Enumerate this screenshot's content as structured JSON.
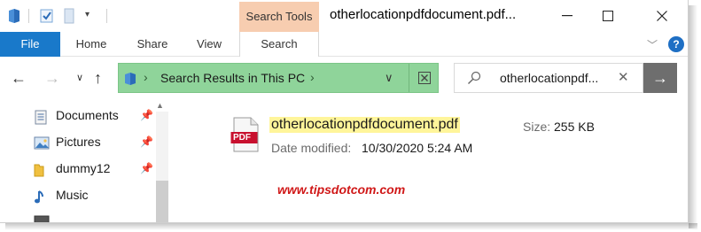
{
  "window": {
    "title": "otherlocationpdfdocument.pdf...",
    "context_tab": "Search Tools",
    "controls": [
      "minimize",
      "maximize",
      "close"
    ]
  },
  "ribbon": {
    "tabs": [
      "File",
      "Home",
      "Share",
      "View",
      "Search"
    ],
    "active_tab": "Search",
    "help_label": "?"
  },
  "navigation": {
    "address": {
      "text": "Search Results in This PC"
    },
    "search": {
      "value": "otherlocationpdf..."
    }
  },
  "nav_pane": {
    "items": [
      {
        "label": "Documents",
        "icon": "documents-icon",
        "pinned": true
      },
      {
        "label": "Pictures",
        "icon": "pictures-icon",
        "pinned": true
      },
      {
        "label": "dummy12",
        "icon": "folder-icon",
        "pinned": true
      },
      {
        "label": "Music",
        "icon": "music-icon",
        "pinned": false
      }
    ]
  },
  "results": [
    {
      "name": "otherlocationpdfdocument.pdf",
      "size_label": "Size:",
      "size": "255 KB",
      "date_label": "Date modified:",
      "date_modified": "10/30/2020 5:24 AM",
      "icon": "pdf-icon",
      "icon_text": "PDF"
    }
  ],
  "watermark": "www.tipsdotcom.com",
  "colors": {
    "file_tab": "#1979ca",
    "search_tools_tab": "#f7cdb0",
    "address_bar": "#8fd49a",
    "highlight": "#fff59a",
    "watermark": "#d01818",
    "pdf_red": "#c8102e"
  }
}
